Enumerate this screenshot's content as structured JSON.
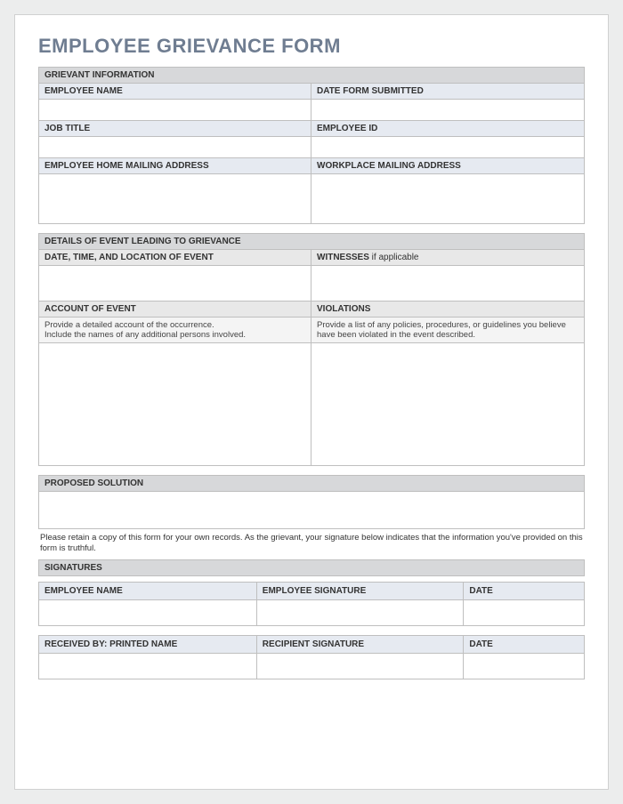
{
  "title": "EMPLOYEE GRIEVANCE FORM",
  "grievant": {
    "section": "GRIEVANT INFORMATION",
    "employee_name_label": "EMPLOYEE NAME",
    "date_submitted_label": "DATE FORM SUBMITTED",
    "job_title_label": "JOB TITLE",
    "employee_id_label": "EMPLOYEE ID",
    "home_addr_label": "EMPLOYEE HOME MAILING ADDRESS",
    "work_addr_label": "WORKPLACE MAILING ADDRESS",
    "employee_name": "",
    "date_submitted": "",
    "job_title": "",
    "employee_id": "",
    "home_addr": "",
    "work_addr": ""
  },
  "details": {
    "section": "DETAILS OF EVENT LEADING TO GRIEVANCE",
    "datetime_label": "DATE, TIME, AND LOCATION OF EVENT",
    "witnesses_label_bold": "WITNESSES",
    "witnesses_label_rest": " if applicable",
    "account_label": "ACCOUNT OF EVENT",
    "violations_label": "VIOLATIONS",
    "account_hint": "Provide a detailed account of the occurrence.\nInclude the names of any additional persons involved.",
    "violations_hint": "Provide a list of any policies, procedures, or guidelines you believe have been violated in the event described.",
    "datetime": "",
    "witnesses": "",
    "account": "",
    "violations": ""
  },
  "solution": {
    "section": "PROPOSED SOLUTION",
    "text": ""
  },
  "note": "Please retain a copy of this form for your own records.  As the grievant, your signature below indicates that the information you've provided on this form is truthful.",
  "signatures": {
    "section": "SIGNATURES",
    "emp_name_label": "EMPLOYEE NAME",
    "emp_sig_label": "EMPLOYEE SIGNATURE",
    "date_label": "DATE",
    "recv_label": "RECEIVED BY: PRINTED NAME",
    "recip_sig_label": "RECIPIENT SIGNATURE",
    "date2_label": "DATE",
    "emp_name": "",
    "emp_sig": "",
    "date1": "",
    "recv": "",
    "recip_sig": "",
    "date2": ""
  }
}
